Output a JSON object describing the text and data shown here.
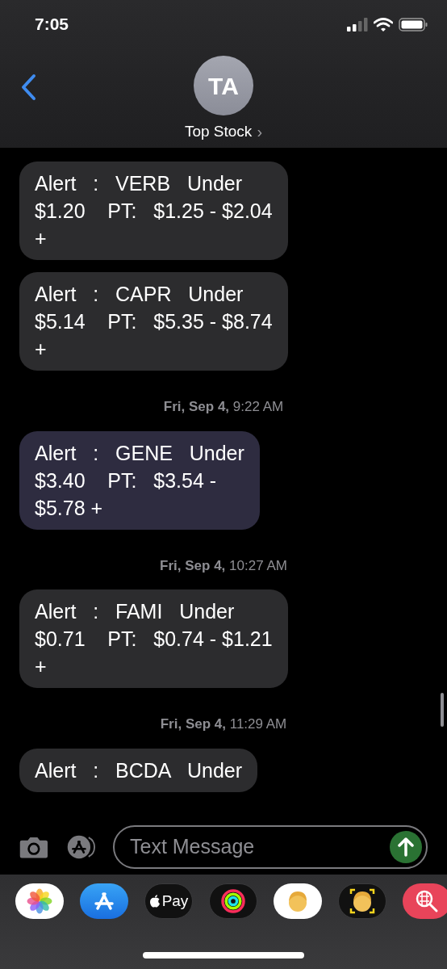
{
  "status_bar": {
    "time": "7:05"
  },
  "header": {
    "avatar_initials": "TA",
    "contact_name": "Top Stock",
    "chevron": "›"
  },
  "messages": [
    {
      "kind": "bubble",
      "text": "Alert   :   VERB   Under\n$1.20    PT:   $1.25 - $2.04\n+",
      "selected": false
    },
    {
      "kind": "bubble",
      "text": "Alert   :   CAPR   Under\n$5.14    PT:   $5.35 - $8.74\n+",
      "selected": false
    },
    {
      "kind": "timestamp",
      "text": "**Fri, Sep 4,** 9:22 AM"
    },
    {
      "kind": "bubble",
      "text": "Alert   :   GENE   Under\n$3.40    PT:   $3.54 -\n$5.78 +",
      "selected": true
    },
    {
      "kind": "timestamp",
      "text": "**Fri, Sep 4,** 10:27 AM"
    },
    {
      "kind": "bubble",
      "text": "Alert   :   FAMI   Under\n$0.71    PT:   $0.74 - $1.21\n+",
      "selected": false
    },
    {
      "kind": "timestamp",
      "text": "**Fri, Sep 4,** 11:29 AM"
    },
    {
      "kind": "bubble",
      "text": "Alert   :   BCDA   Under",
      "selected": false
    }
  ],
  "composer": {
    "placeholder": "Text Message"
  },
  "app_drawer": [
    {
      "kind": "photos"
    },
    {
      "kind": "appstore"
    },
    {
      "kind": "pay",
      "label": "Pay"
    },
    {
      "kind": "activity"
    },
    {
      "kind": "memoji"
    },
    {
      "kind": "memoji_camera"
    },
    {
      "kind": "search"
    }
  ]
}
